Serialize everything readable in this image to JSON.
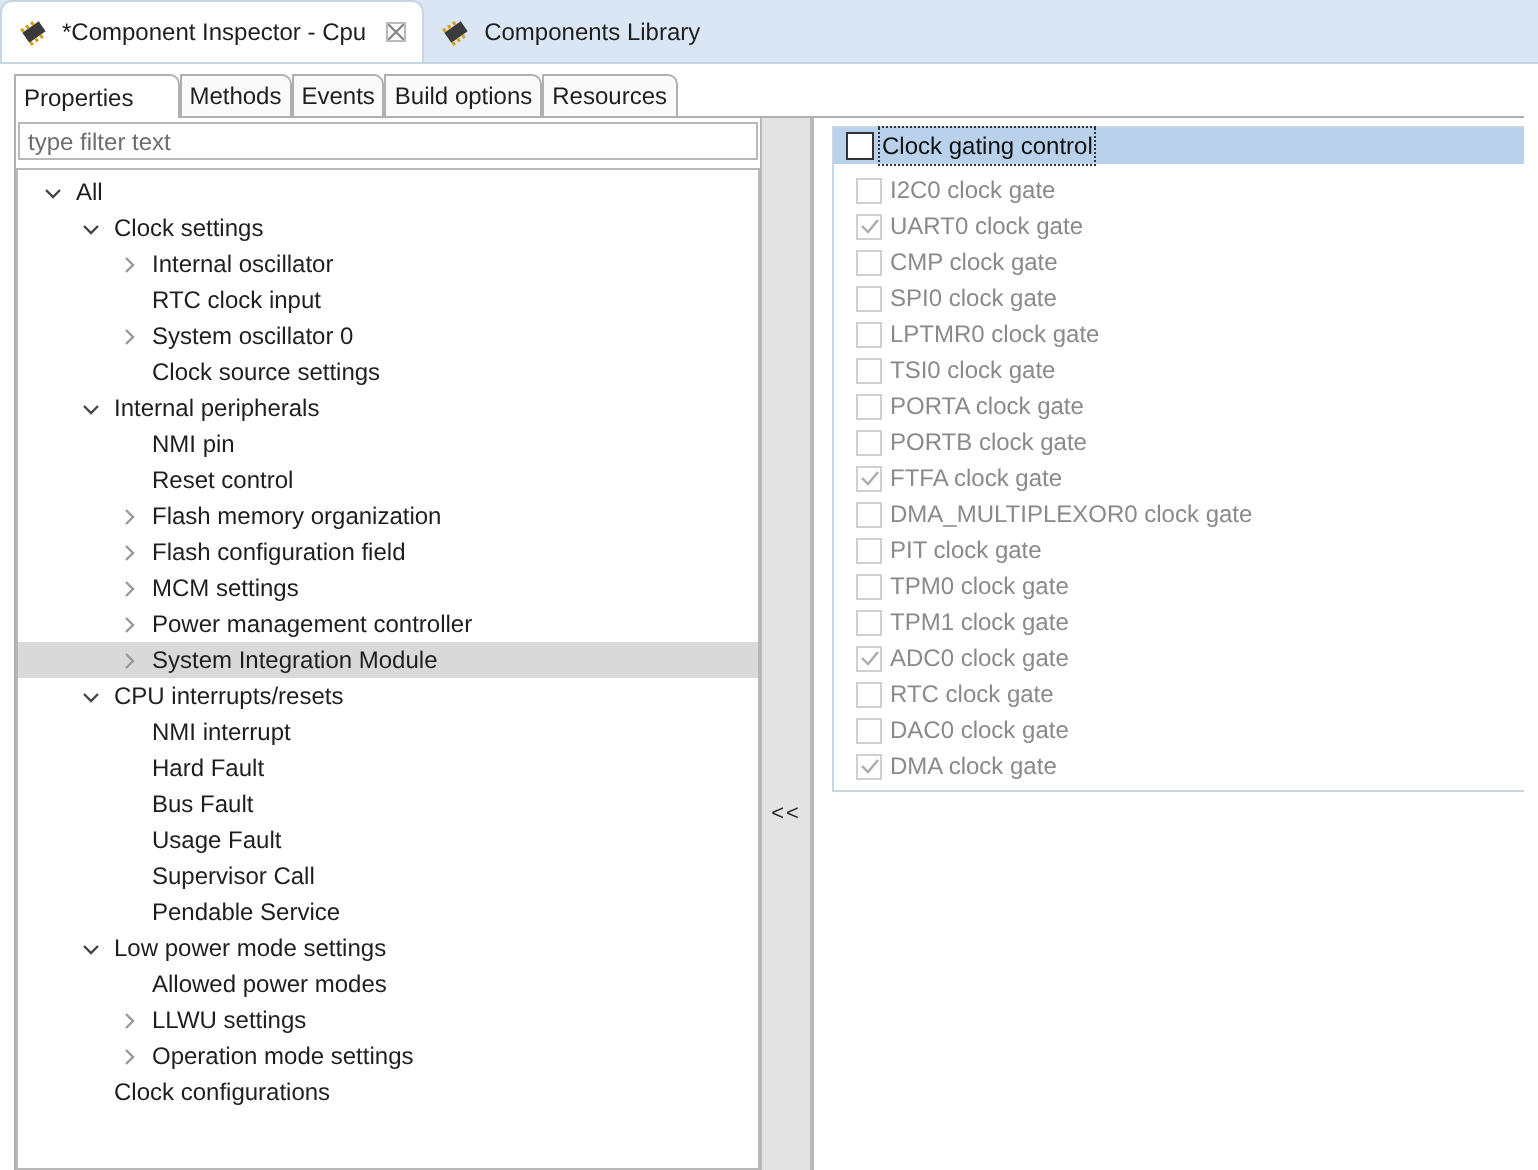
{
  "editor_tabs": [
    {
      "label": "*Component Inspector - Cpu",
      "selected": true,
      "closable": true
    },
    {
      "label": "Components Library",
      "selected": false,
      "closable": false
    }
  ],
  "inspector_tabs": [
    {
      "label": "Properties",
      "selected": true
    },
    {
      "label": "Methods",
      "selected": false
    },
    {
      "label": "Events",
      "selected": false
    },
    {
      "label": "Build options",
      "selected": false
    },
    {
      "label": "Resources",
      "selected": false
    }
  ],
  "filter": {
    "placeholder": "type filter text"
  },
  "tree": [
    {
      "label": "All",
      "kind": "branch",
      "expanded": true,
      "selected": false,
      "children": [
        {
          "label": "Clock settings",
          "kind": "branch",
          "expanded": true,
          "selected": false,
          "children": [
            {
              "label": "Internal oscillator",
              "kind": "branch",
              "expanded": false,
              "selected": false
            },
            {
              "label": "RTC clock input",
              "kind": "leaf",
              "selected": false
            },
            {
              "label": "System oscillator 0",
              "kind": "branch",
              "expanded": false,
              "selected": false
            },
            {
              "label": "Clock source settings",
              "kind": "leaf",
              "selected": false
            }
          ]
        },
        {
          "label": "Internal peripherals",
          "kind": "branch",
          "expanded": true,
          "selected": false,
          "children": [
            {
              "label": "NMI pin",
              "kind": "leaf",
              "selected": false
            },
            {
              "label": "Reset control",
              "kind": "leaf",
              "selected": false
            },
            {
              "label": "Flash memory organization",
              "kind": "branch",
              "expanded": false,
              "selected": false
            },
            {
              "label": "Flash configuration field",
              "kind": "branch",
              "expanded": false,
              "selected": false
            },
            {
              "label": "MCM settings",
              "kind": "branch",
              "expanded": false,
              "selected": false
            },
            {
              "label": "Power management controller",
              "kind": "branch",
              "expanded": false,
              "selected": false
            },
            {
              "label": "System Integration Module",
              "kind": "branch",
              "expanded": false,
              "selected": true
            }
          ]
        },
        {
          "label": "CPU interrupts/resets",
          "kind": "branch",
          "expanded": true,
          "selected": false,
          "children": [
            {
              "label": "NMI interrupt",
              "kind": "leaf",
              "selected": false
            },
            {
              "label": "Hard Fault",
              "kind": "leaf",
              "selected": false
            },
            {
              "label": "Bus Fault",
              "kind": "leaf",
              "selected": false
            },
            {
              "label": "Usage Fault",
              "kind": "leaf",
              "selected": false
            },
            {
              "label": "Supervisor Call",
              "kind": "leaf",
              "selected": false
            },
            {
              "label": "Pendable Service",
              "kind": "leaf",
              "selected": false
            }
          ]
        },
        {
          "label": "Low power mode settings",
          "kind": "branch",
          "expanded": true,
          "selected": false,
          "children": [
            {
              "label": "Allowed power modes",
              "kind": "leaf",
              "selected": false
            },
            {
              "label": "LLWU settings",
              "kind": "branch",
              "expanded": false,
              "selected": false
            },
            {
              "label": "Operation mode settings",
              "kind": "branch",
              "expanded": false,
              "selected": false
            }
          ]
        },
        {
          "label": "Clock configurations",
          "kind": "leaf",
          "selected": false
        }
      ]
    }
  ],
  "collapse_button": "<<",
  "group": {
    "label": "Clock gating control",
    "checked": false,
    "gates": [
      {
        "label": "I2C0 clock gate",
        "checked": false,
        "disabled": true
      },
      {
        "label": "UART0 clock gate",
        "checked": true,
        "disabled": true
      },
      {
        "label": "CMP clock gate",
        "checked": false,
        "disabled": true
      },
      {
        "label": "SPI0 clock gate",
        "checked": false,
        "disabled": true
      },
      {
        "label": "LPTMR0 clock gate",
        "checked": false,
        "disabled": true
      },
      {
        "label": "TSI0 clock gate",
        "checked": false,
        "disabled": true
      },
      {
        "label": "PORTA clock gate",
        "checked": false,
        "disabled": true
      },
      {
        "label": "PORTB clock gate",
        "checked": false,
        "disabled": true
      },
      {
        "label": "FTFA clock gate",
        "checked": true,
        "disabled": true
      },
      {
        "label": "DMA_MULTIPLEXOR0 clock gate",
        "checked": false,
        "disabled": true
      },
      {
        "label": "PIT clock gate",
        "checked": false,
        "disabled": true
      },
      {
        "label": "TPM0 clock gate",
        "checked": false,
        "disabled": true
      },
      {
        "label": "TPM1 clock gate",
        "checked": false,
        "disabled": true
      },
      {
        "label": "ADC0 clock gate",
        "checked": true,
        "disabled": true
      },
      {
        "label": "RTC clock gate",
        "checked": false,
        "disabled": true
      },
      {
        "label": "DAC0 clock gate",
        "checked": false,
        "disabled": true
      },
      {
        "label": "DMA clock gate",
        "checked": true,
        "disabled": true
      }
    ]
  }
}
